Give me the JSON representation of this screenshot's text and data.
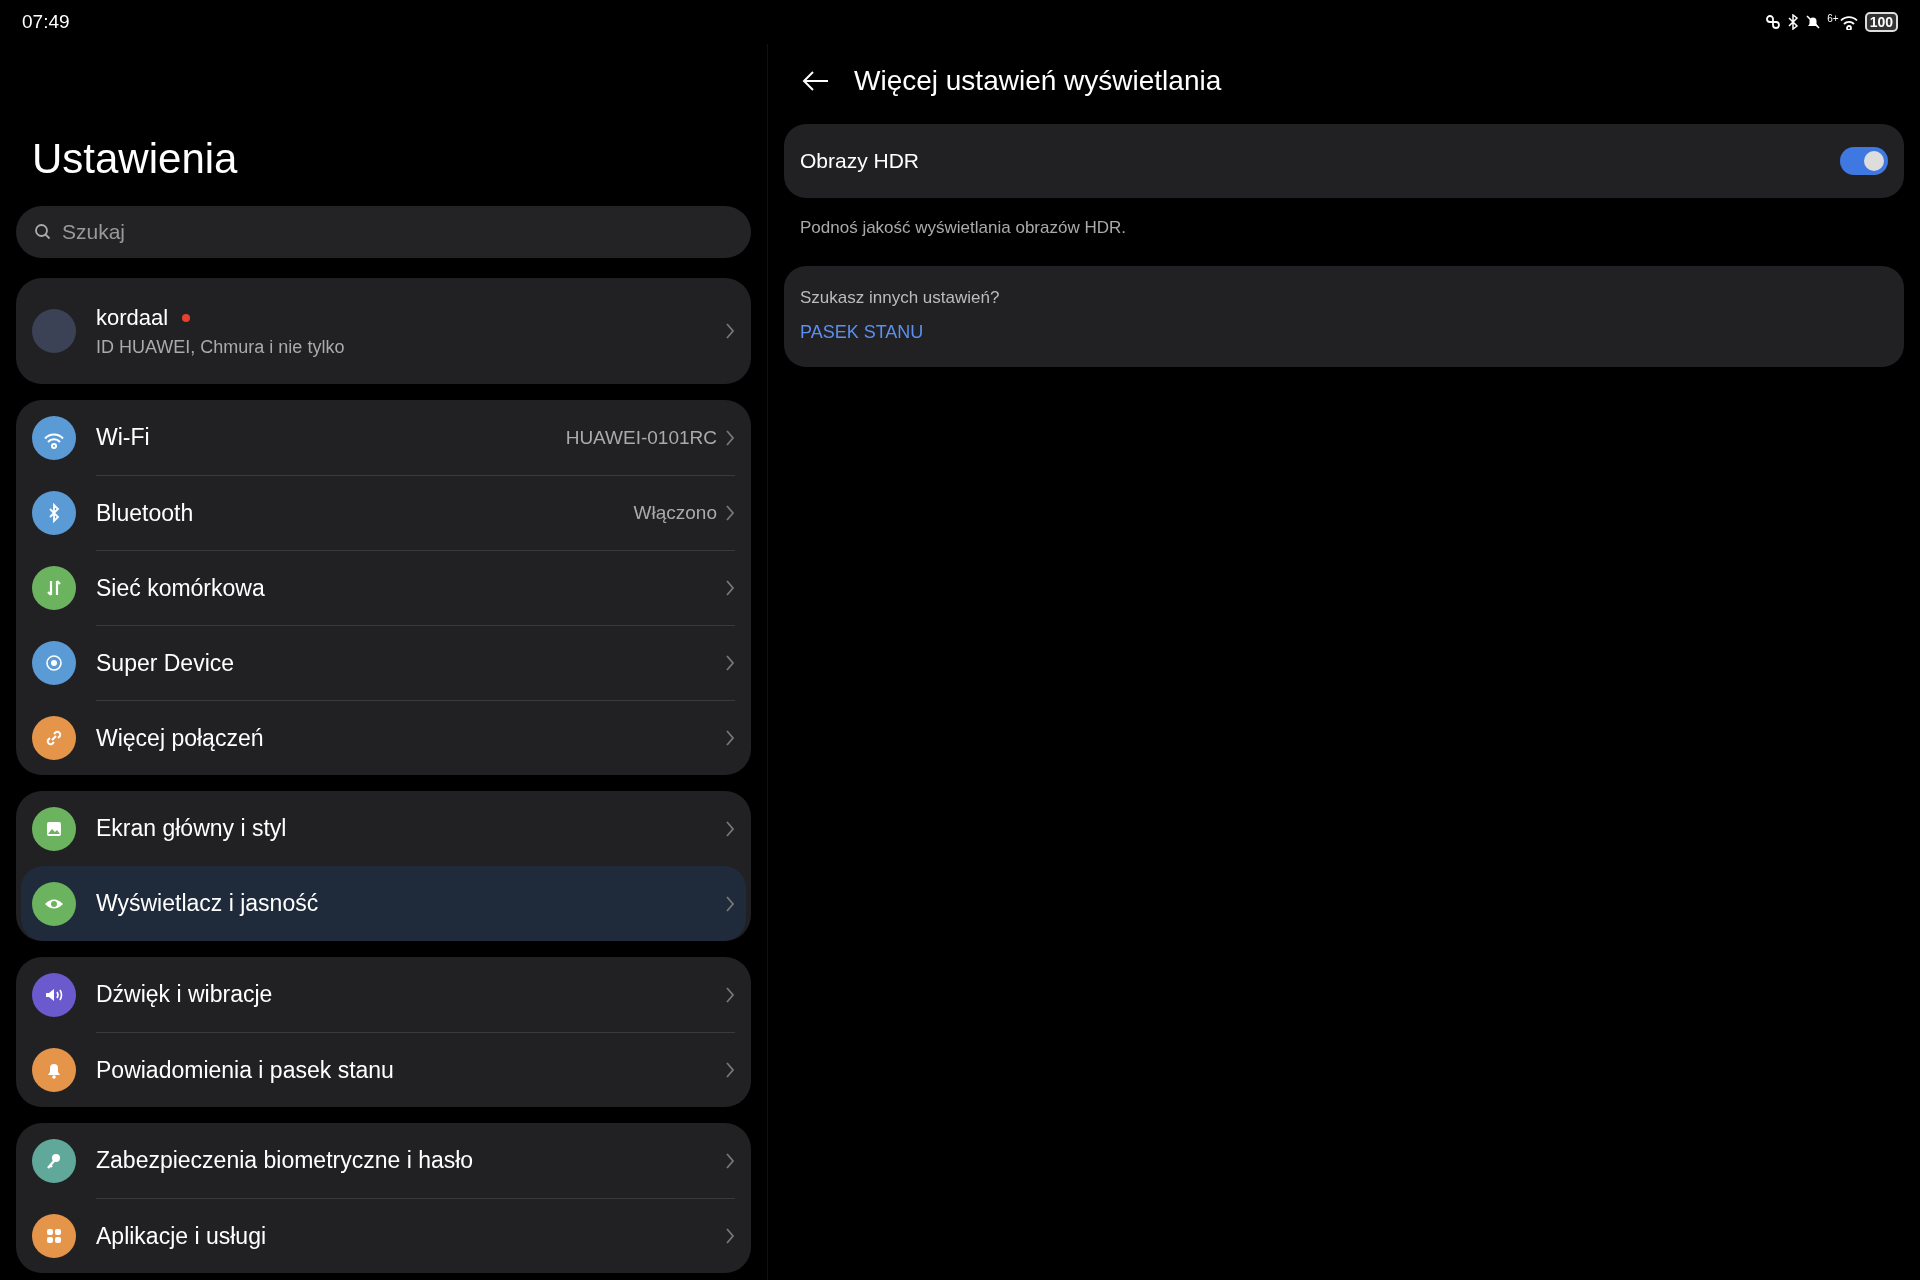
{
  "status_bar": {
    "time": "07:49",
    "wifi_label": "6+",
    "battery": "100"
  },
  "sidebar": {
    "title": "Ustawienia",
    "search": {
      "placeholder": "Szukaj"
    },
    "profile": {
      "name": "kordaal",
      "subtitle": "ID HUAWEI, Chmura i nie tylko",
      "unread": true
    },
    "groups": [
      {
        "items": [
          {
            "label": "Wi-Fi",
            "value": "HUAWEI-0101RC",
            "color": "#5b9bd5",
            "selected": false
          },
          {
            "label": "Bluetooth",
            "value": "Włączono",
            "color": "#5b9bd5",
            "selected": false
          },
          {
            "label": "Sieć komórkowa",
            "color": "#6bb35f",
            "selected": false
          },
          {
            "label": "Super Device",
            "color": "#5b9bd5",
            "selected": false
          },
          {
            "label": "Więcej połączeń",
            "color": "#e5954a",
            "selected": false
          }
        ]
      },
      {
        "items": [
          {
            "label": "Ekran główny i styl",
            "color": "#6bb35f",
            "selected": false
          },
          {
            "label": "Wyświetlacz i jasność",
            "color": "#6bb35f",
            "selected": true
          }
        ]
      },
      {
        "items": [
          {
            "label": "Dźwięk i wibracje",
            "color": "#6a5acd",
            "selected": false
          },
          {
            "label": "Powiadomienia i pasek stanu",
            "color": "#e5954a",
            "selected": false
          }
        ]
      },
      {
        "items": [
          {
            "label": "Zabezpieczenia biometryczne i hasło",
            "color": "#5fa89a",
            "selected": false
          },
          {
            "label": "Aplikacje i usługi",
            "color": "#e5954a",
            "selected": false
          }
        ]
      }
    ]
  },
  "detail": {
    "title": "Więcej ustawień wyświetlania",
    "toggle": {
      "label": "Obrazy HDR",
      "on": true
    },
    "description": "Podnoś jakość wyświetlania obrazów HDR.",
    "suggestion": {
      "question": "Szukasz innych ustawień?",
      "link": "PASEK STANU"
    }
  }
}
